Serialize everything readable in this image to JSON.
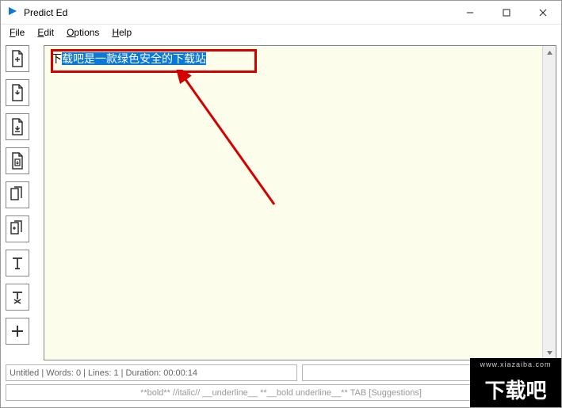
{
  "window": {
    "title": "Predict Ed"
  },
  "menu": {
    "file": "File",
    "edit": "Edit",
    "options": "Options",
    "help": "Help"
  },
  "editor": {
    "first_char": "下",
    "selected_text": "载吧是一款绿色安全的下载站"
  },
  "status": {
    "left": "Untitled | Words: 0 | Lines: 1 | Duration: 00:00:14",
    "right": ""
  },
  "hint": "**bold**   //italic//   __underline__   **__bold underline__**   TAB [Suggestions]",
  "toolbar": [
    "new-file",
    "open-file",
    "save-file",
    "save-as",
    "copy",
    "paste",
    "text-tool",
    "clear-format",
    "add"
  ],
  "watermark": {
    "url": "www.xiazaiba.com",
    "text": "下载吧"
  }
}
